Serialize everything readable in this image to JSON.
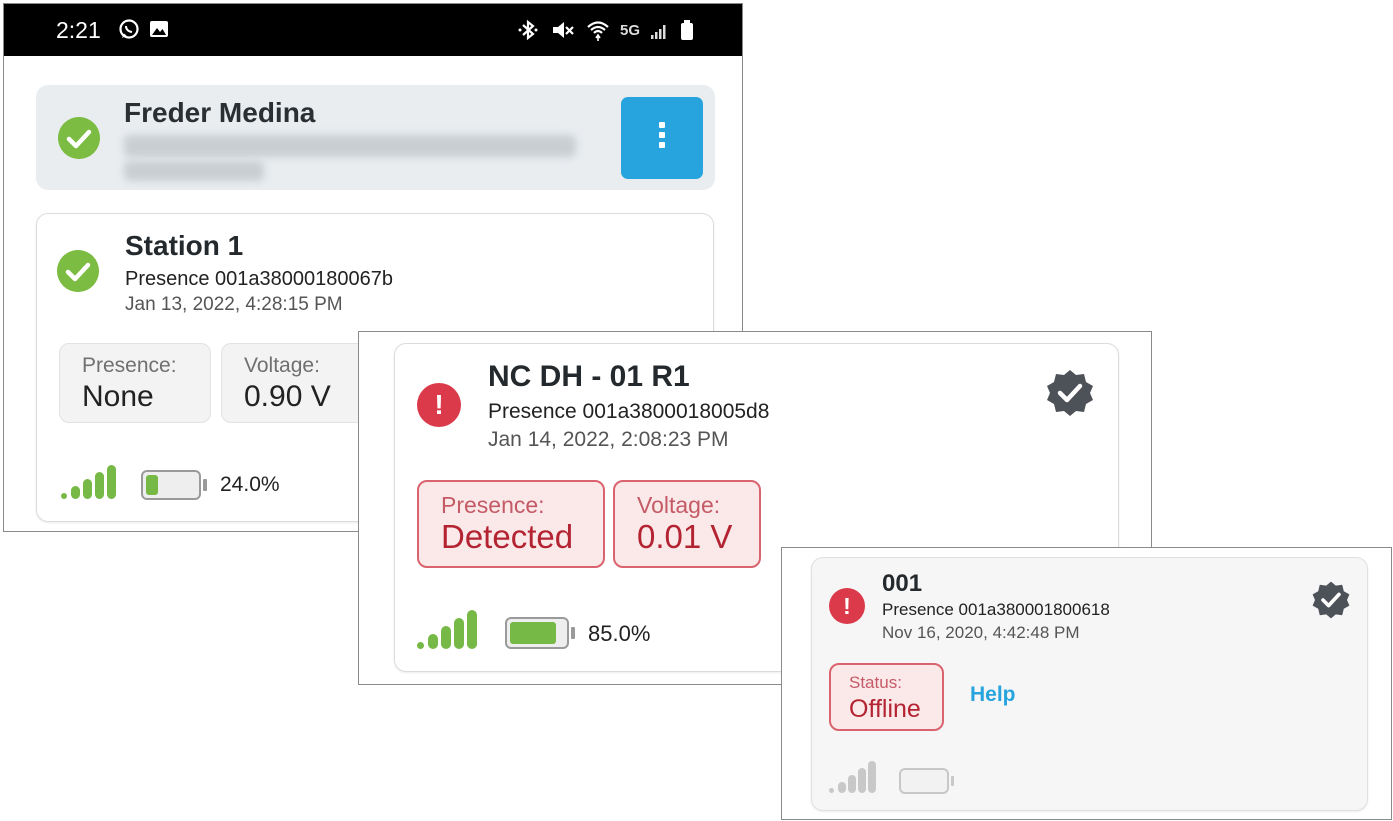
{
  "status_bar": {
    "time": "2:21",
    "left_icons": [
      "whatsapp-icon",
      "image-icon"
    ],
    "right_icons": [
      "bluetooth-icon",
      "mute-icon",
      "wifi-icon",
      "cell-signal-icon",
      "battery-icon"
    ],
    "network": "5G"
  },
  "account": {
    "name": "Freder Medina",
    "status_icon": "check-circle-icon",
    "menu_icon": "more-vertical-icon"
  },
  "station1": {
    "title": "Station 1",
    "device": "Presence 001a38000180067b",
    "timestamp": "Jan 13, 2022, 4:28:15 PM",
    "status_icon": "check-circle-icon",
    "readings": [
      {
        "label": "Presence:",
        "value": "None"
      },
      {
        "label": "Voltage:",
        "value": "0.90 V"
      }
    ],
    "signal_bars": 5,
    "battery_level": 0.24,
    "battery_pct": "24.0%"
  },
  "device2": {
    "title": "NC DH - 01 R1",
    "device": "Presence 001a3800018005d8",
    "timestamp": "Jan 14, 2022, 2:08:23 PM",
    "status_icon": "alert-circle-icon",
    "badge_icon": "verified-badge-icon",
    "readings": [
      {
        "label": "Presence:",
        "value": "Detected"
      },
      {
        "label": "Voltage:",
        "value": "0.01 V"
      }
    ],
    "signal_bars": 5,
    "battery_level": 0.85,
    "battery_pct": "85.0%"
  },
  "device3": {
    "title": "001",
    "device": "Presence 001a380001800618",
    "timestamp": "Nov 16, 2020, 4:42:48 PM",
    "status_icon": "alert-circle-icon",
    "badge_icon": "verified-badge-icon",
    "status_label": "Status:",
    "status_value": "Offline",
    "help_label": "Help",
    "signal_bars": 0,
    "battery_level": 0
  },
  "colors": {
    "ok_green": "#7cbc43",
    "alert_red": "#db3a4a",
    "accent_blue": "#27a4dd",
    "warn_border": "#d9646f",
    "warn_bg": "#fbe9ea"
  }
}
